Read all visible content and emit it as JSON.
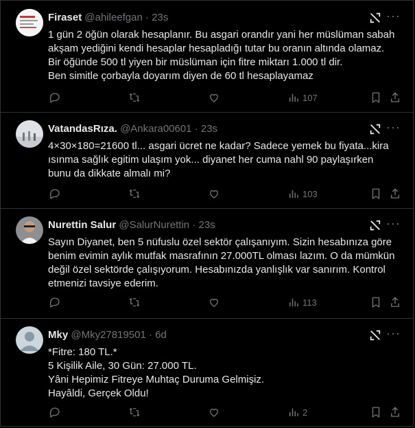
{
  "tweets": [
    {
      "name": "Firaset",
      "handle": "@ahileefgan",
      "time": "23s",
      "text": "1 gün 2 öğün olarak hesaplanır. Bu asgari orandır yani her müslüman sabah\nakşam yediğini kendi hesaplar hesapladığı tutar bu oranın altında olamaz.\nBir öğünde 500 tl yiyen bir müslüman için fitre miktarı 1.000 tl dir.\nBen simitle çorbayla doyarım diyen de 60 tl hesaplayamaz",
      "views": "107"
    },
    {
      "name": "VatandasRıza.",
      "handle": "@Ankara00601",
      "time": "23s",
      "text": "4×30×180=21600 tl... asgari ücret ne kadar?  Sadece yemek bu fiyata...kira\nısınma sağlık egitim ulaşım yok... diyanet her cuma nahl 90 paylaşırken\nbunu da dikkate almalı mi?",
      "views": "103"
    },
    {
      "name": "Nurettin Salur",
      "handle": "@SalurNurettin",
      "time": "23s",
      "text": "Sayın Diyanet, ben 5 nüfuslu özel sektör çalışanıyım. Sizin hesabınıza göre\nbenim evimin aylık mutfak masrafının 27.000TL olması lazım. O da mümkün\ndeğil özel sektörde çalışıyorum. Hesabınızda yanlışlık var sanırım. Kontrol\netmenizi tavsiye ederim.",
      "views": "113"
    },
    {
      "name": "Mky",
      "handle": "@Mky27819501",
      "time": "6d",
      "text": "*Fitre: 180 TL.*\n5 Kişilik Aile, 30 Gün: 27.000 TL.\nYâni Hepimiz Fitreye Muhtaç Duruma Gelmişiz.\nHayâldi, Gerçek Oldu!",
      "views": "2"
    }
  ],
  "icons": [
    "reply-icon",
    "retweet-icon",
    "like-icon",
    "views-icon",
    "bookmark-icon",
    "share-icon",
    "grok-icon",
    "more-icon"
  ],
  "colors": {
    "background": "#000000",
    "text": "#e7e9ea",
    "muted": "#71767b",
    "border": "#2f3336"
  }
}
